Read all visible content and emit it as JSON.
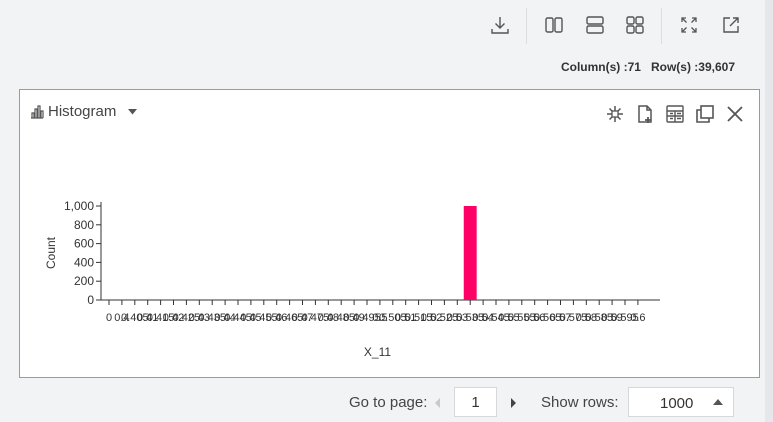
{
  "toolbar": {
    "icons": [
      "download-icon",
      "split-columns-icon",
      "split-rows-icon",
      "grid-icon",
      "fullscreen-icon",
      "open-external-icon"
    ]
  },
  "summary": {
    "columns_text": "Column(s) :71",
    "rows_text": "Row(s) :39,607"
  },
  "panel": {
    "chart_type_label": "Histogram",
    "tools": [
      "scatter-settings-icon",
      "add-document-icon",
      "table-view-icon",
      "duplicate-icon",
      "close-icon"
    ]
  },
  "chart_data": {
    "type": "bar",
    "xlabel": "X_11",
    "ylabel": "Count",
    "ylim": [
      0,
      1000
    ],
    "yticks": [
      "0",
      "200",
      "400",
      "600",
      "800",
      "1,000"
    ],
    "categories": [
      "0",
      "0.4",
      "0.405",
      "0.41",
      "0.415",
      "0.42",
      "0.425",
      "0.43",
      "0.435",
      "0.44",
      "0.445",
      "0.45",
      "0.455",
      "0.46",
      "0.465",
      "0.47",
      "0.475",
      "0.48",
      "0.485",
      "0.49",
      "0.495",
      "0.5",
      "0.505",
      "0.51",
      "0.515",
      "0.52",
      "0.525",
      "0.53",
      "0.535",
      "0.54",
      "0.545",
      "0.55",
      "0.555",
      "0.56",
      "0.565",
      "0.57",
      "0.575",
      "0.58",
      "0.585",
      "0.59",
      "0.595",
      "0.6"
    ],
    "values": [
      0,
      0,
      0,
      0,
      0,
      0,
      0,
      0,
      0,
      0,
      0,
      0,
      0,
      0,
      0,
      0,
      0,
      0,
      0,
      0,
      0,
      0,
      0,
      0,
      0,
      0,
      0,
      0,
      1000,
      0,
      0,
      0,
      0,
      0,
      0,
      0,
      0,
      0,
      0,
      0,
      0,
      0
    ],
    "bar_color": "#ff0066"
  },
  "pagination": {
    "goto_label": "Go to page:",
    "page_value": "1",
    "show_rows_label": "Show rows:",
    "rows_value": "1000"
  },
  "colors": {
    "panel_border": "#8e98c9",
    "background": "#f2f3f5",
    "bar": "#ff0066"
  }
}
